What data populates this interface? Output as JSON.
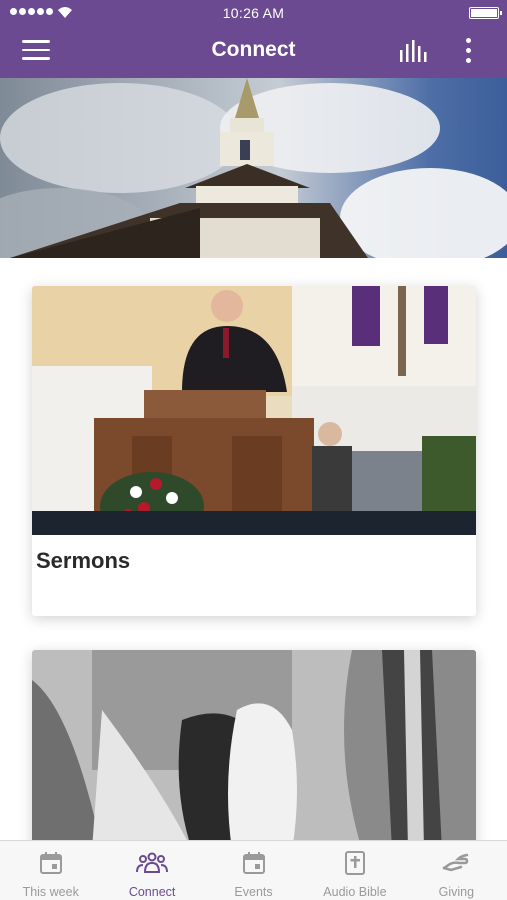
{
  "status_bar": {
    "time": "10:26 AM"
  },
  "app_bar": {
    "title": "Connect"
  },
  "cards": [
    {
      "label": "Sermons"
    },
    {
      "label": ""
    }
  ],
  "tabs": [
    {
      "label": "This week",
      "icon": "calendar-icon",
      "active": false
    },
    {
      "label": "Connect",
      "icon": "people-icon",
      "active": true
    },
    {
      "label": "Events",
      "icon": "calendar-icon",
      "active": false
    },
    {
      "label": "Audio Bible",
      "icon": "bible-icon",
      "active": false
    },
    {
      "label": "Giving",
      "icon": "giving-hand-icon",
      "active": false
    }
  ],
  "colors": {
    "brand": "#6b4a92",
    "tab_active": "#6b4a92",
    "tab_inactive": "#9a9a9a",
    "background": "#ffffff"
  }
}
